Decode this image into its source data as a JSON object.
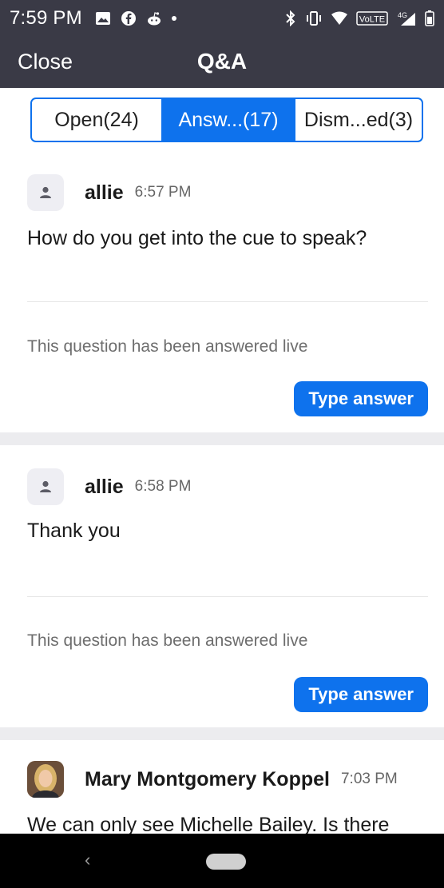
{
  "status_bar": {
    "time": "7:59 PM",
    "left_icons": [
      "image-icon",
      "facebook-icon",
      "reddit-icon",
      "dot-icon"
    ],
    "right_icons": [
      "bluetooth-icon",
      "vibrate-icon",
      "wifi-icon",
      "volte-icon",
      "signal-icon",
      "battery-icon"
    ],
    "network_label": "4G",
    "volte_label": "VoLTE"
  },
  "header": {
    "close_label": "Close",
    "title": "Q&A"
  },
  "tabs": [
    {
      "label": "Open(24)",
      "active": false
    },
    {
      "label": "Answ...(17)",
      "active": true
    },
    {
      "label": "Dism...ed(3)",
      "active": false
    }
  ],
  "questions": [
    {
      "author": "allie",
      "time": "6:57 PM",
      "text": "How do you get into the cue to speak?",
      "answered_note": "This question has been answered live",
      "button_label": "Type answer",
      "avatar": "default-user-icon"
    },
    {
      "author": "allie",
      "time": "6:58 PM",
      "text": "Thank you",
      "answered_note": "This question has been answered live",
      "button_label": "Type answer",
      "avatar": "default-user-icon"
    },
    {
      "author": "Mary Montgomery Koppel",
      "time": "7:03 PM",
      "text": "We can only see Michelle Bailey. Is there",
      "avatar": "profile-photo"
    }
  ],
  "colors": {
    "header_bg": "#3a3a46",
    "accent": "#0e72ed",
    "separator": "#ececef"
  }
}
